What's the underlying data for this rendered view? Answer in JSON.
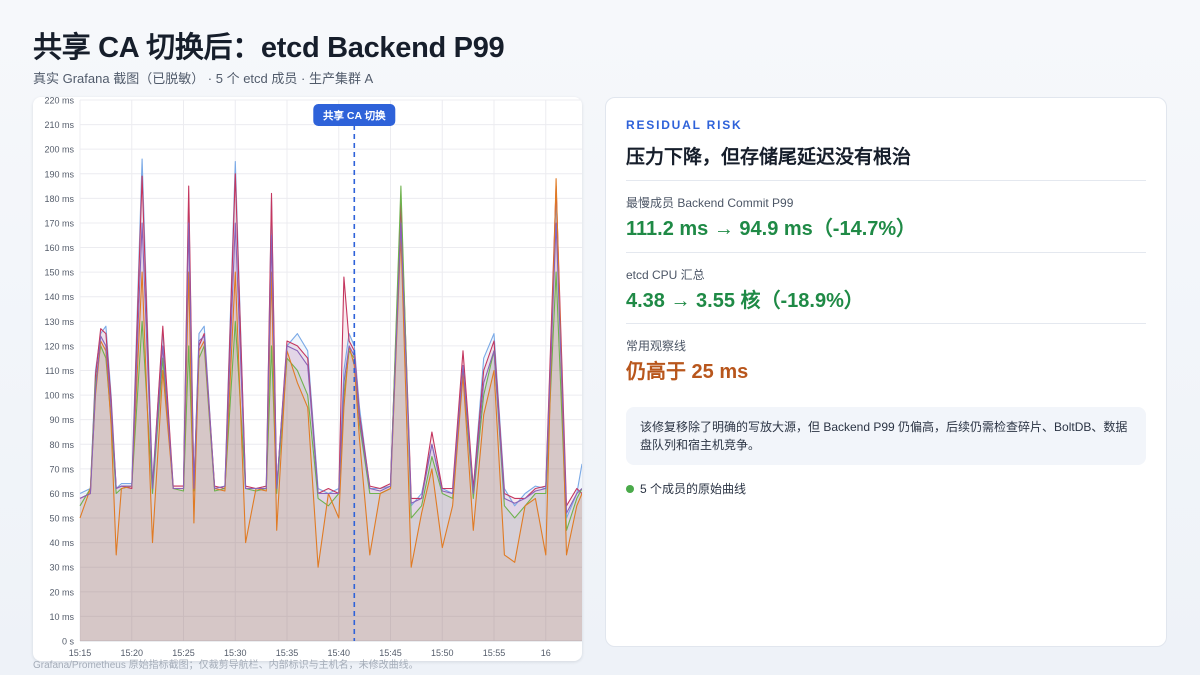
{
  "page": {
    "title": "共享 CA 切换后：etcd Backend P99",
    "subtitle": "真实 Grafana 截图（已脱敏） · 5 个 etcd 成员 · 生产集群 A",
    "caption": "Grafana/Prometheus 原始指标截图；仅裁剪导航栏、内部标识与主机名，未修改曲线。"
  },
  "chart": {
    "switch_label": "共享 CA 切换"
  },
  "chart_data": {
    "type": "line",
    "x_ticks": [
      "15:15",
      "15:20",
      "15:25",
      "15:30",
      "15:35",
      "15:40",
      "15:45",
      "15:50",
      "15:55",
      "16"
    ],
    "y_ticks": [
      "0 s",
      "10 ms",
      "20 ms",
      "30 ms",
      "40 ms",
      "50 ms",
      "60 ms",
      "70 ms",
      "80 ms",
      "90 ms",
      "100 ms",
      "110 ms",
      "120 ms",
      "130 ms",
      "140 ms",
      "150 ms",
      "160 ms",
      "170 ms",
      "180 ms",
      "190 ms",
      "200 ms",
      "210 ms",
      "220 ms"
    ],
    "ylim": [
      0,
      220
    ],
    "xlim": [
      0,
      48.5
    ],
    "x_unit": "minutes after 15:15",
    "switch_x": 26.5,
    "colors": [
      "#7aa9e6",
      "#c4365f",
      "#6fb24e",
      "#e07b24",
      "#8a63b8"
    ],
    "grid": true,
    "series": [
      {
        "x": [
          0,
          1,
          1.5,
          2,
          2.5,
          3,
          3.5,
          4,
          5,
          6,
          7,
          8,
          9,
          10,
          10.5,
          11,
          11.5,
          12,
          13,
          14,
          15,
          16,
          17,
          18,
          18.5,
          19,
          20,
          21,
          22,
          23,
          24,
          25,
          25.5,
          26,
          26.5,
          27,
          28,
          29,
          30,
          31,
          32,
          33,
          34,
          35,
          36,
          37,
          38,
          39,
          40,
          41,
          42,
          43,
          44,
          45,
          46,
          47,
          48,
          48.5
        ],
        "y": [
          60,
          62,
          110,
          125,
          128,
          100,
          62,
          64,
          64,
          196,
          64,
          126,
          62,
          62,
          180,
          62,
          125,
          128,
          62,
          63,
          195,
          62,
          62,
          63,
          180,
          62,
          120,
          125,
          118,
          62,
          60,
          62,
          110,
          125,
          120,
          95,
          62,
          62,
          63,
          175,
          55,
          60,
          80,
          62,
          60,
          112,
          62,
          115,
          125,
          62,
          55,
          60,
          63,
          62,
          180,
          50,
          60,
          72
        ]
      },
      {
        "x": [
          0,
          1,
          1.5,
          2,
          2.5,
          3,
          3.5,
          4,
          5,
          6,
          7,
          8,
          9,
          10,
          10.5,
          11,
          11.5,
          12,
          13,
          14,
          15,
          16,
          17,
          18,
          18.5,
          19,
          20,
          21,
          22,
          23,
          24,
          25,
          25.5,
          26,
          26.5,
          27,
          28,
          29,
          30,
          31,
          32,
          33,
          34,
          35,
          36,
          37,
          38,
          39,
          40,
          41,
          42,
          43,
          44,
          45,
          46,
          47,
          48,
          48.5
        ],
        "y": [
          58,
          60,
          108,
          127,
          125,
          98,
          62,
          63,
          62,
          189,
          62,
          128,
          63,
          63,
          185,
          62,
          120,
          125,
          63,
          62,
          190,
          63,
          62,
          63,
          182,
          62,
          122,
          120,
          115,
          60,
          62,
          60,
          148,
          122,
          118,
          92,
          63,
          62,
          64,
          178,
          58,
          58,
          85,
          62,
          62,
          118,
          62,
          110,
          122,
          60,
          58,
          58,
          62,
          63,
          185,
          55,
          62,
          60
        ]
      },
      {
        "x": [
          0,
          1,
          1.5,
          2,
          2.5,
          3,
          3.5,
          4,
          5,
          6,
          7,
          8,
          9,
          10,
          10.5,
          11,
          11.5,
          12,
          13,
          14,
          15,
          16,
          17,
          18,
          18.5,
          19,
          20,
          21,
          22,
          23,
          24,
          25,
          25.5,
          26,
          26.5,
          27,
          28,
          29,
          30,
          31,
          32,
          33,
          34,
          35,
          36,
          37,
          38,
          39,
          40,
          41,
          42,
          43,
          44,
          45,
          46,
          47,
          48,
          48.5
        ],
        "y": [
          55,
          62,
          105,
          120,
          115,
          90,
          60,
          62,
          63,
          130,
          60,
          115,
          62,
          61,
          120,
          61,
          115,
          120,
          61,
          62,
          130,
          62,
          61,
          62,
          120,
          60,
          115,
          110,
          100,
          58,
          55,
          60,
          100,
          118,
          115,
          88,
          60,
          60,
          62,
          185,
          50,
          55,
          75,
          60,
          58,
          110,
          58,
          100,
          118,
          55,
          50,
          55,
          60,
          60,
          150,
          45,
          58,
          62
        ]
      },
      {
        "x": [
          0,
          1,
          1.5,
          2,
          2.5,
          3,
          3.5,
          4,
          5,
          6,
          7,
          8,
          9,
          10,
          10.5,
          11,
          11.5,
          12,
          13,
          14,
          15,
          16,
          17,
          18,
          18.5,
          19,
          20,
          21,
          22,
          23,
          24,
          25,
          25.5,
          26,
          26.5,
          27,
          28,
          29,
          30,
          31,
          32,
          33,
          34,
          35,
          36,
          37,
          38,
          39,
          40,
          41,
          42,
          43,
          44,
          45,
          46,
          47,
          48,
          48.5
        ],
        "y": [
          50,
          62,
          100,
          122,
          118,
          88,
          35,
          62,
          63,
          150,
          40,
          110,
          62,
          62,
          150,
          48,
          118,
          122,
          62,
          61,
          150,
          40,
          62,
          61,
          150,
          45,
          118,
          105,
          95,
          30,
          60,
          50,
          95,
          120,
          112,
          82,
          35,
          60,
          62,
          165,
          30,
          52,
          70,
          38,
          55,
          108,
          45,
          92,
          110,
          35,
          32,
          55,
          58,
          35,
          188,
          35,
          55,
          60
        ]
      },
      {
        "x": [
          0,
          1,
          1.5,
          2,
          2.5,
          3,
          3.5,
          4,
          5,
          6,
          7,
          8,
          9,
          10,
          10.5,
          11,
          11.5,
          12,
          13,
          14,
          15,
          16,
          17,
          18,
          18.5,
          19,
          20,
          21,
          22,
          23,
          24,
          25,
          25.5,
          26,
          26.5,
          27,
          28,
          29,
          30,
          31,
          32,
          33,
          34,
          35,
          36,
          37,
          38,
          39,
          40,
          41,
          42,
          43,
          44,
          45,
          46,
          47,
          48,
          48.5
        ],
        "y": [
          58,
          60,
          102,
          124,
          120,
          95,
          62,
          63,
          63,
          170,
          62,
          120,
          62,
          62,
          170,
          62,
          122,
          124,
          62,
          63,
          170,
          62,
          62,
          62,
          165,
          62,
          120,
          118,
          112,
          60,
          60,
          60,
          105,
          120,
          116,
          90,
          62,
          61,
          63,
          170,
          56,
          58,
          80,
          61,
          60,
          112,
          60,
          105,
          118,
          58,
          56,
          58,
          61,
          62,
          170,
          52,
          60,
          62
        ]
      }
    ]
  },
  "card": {
    "eyebrow": "RESIDUAL RISK",
    "headline": "压力下降，但存储尾延迟没有根治",
    "metrics": [
      {
        "label": "最慢成员 Backend Commit P99",
        "value": "111.2 ms → 94.9 ms（-14.7%）"
      },
      {
        "label": "etcd CPU 汇总",
        "value": "4.38 → 3.55 核（-18.9%）"
      },
      {
        "label": "常用观察线",
        "value": "仍高于 25 ms"
      }
    ],
    "note": "该修复移除了明确的写放大源，但 Backend P99 仍偏高，后续仍需检查碎片、BoltDB、数据盘队列和宿主机竞争。",
    "legend": "5 个成员的原始曲线",
    "colors": {
      "accent": "#2e62d9",
      "good": "#1f8a46",
      "warn": "#b8561c",
      "legend_dot": "#4aaa4a"
    }
  }
}
